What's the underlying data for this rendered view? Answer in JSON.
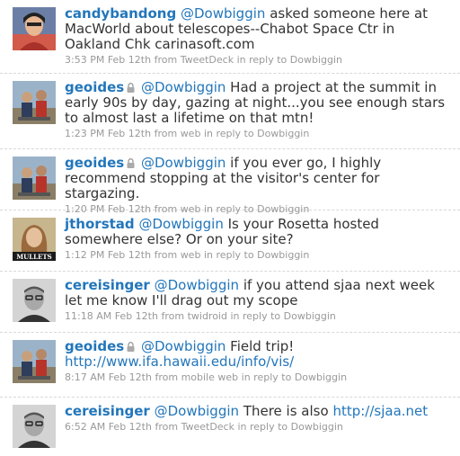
{
  "tweets": [
    {
      "user": "candybandong",
      "avatar": "candybandong-avatar",
      "protected": false,
      "mention": "@Dowbiggin",
      "text": "asked someone here at MacWorld about telescopes--Chabot Space Ctr in Oakland Chk carinasoft.com",
      "link": "",
      "time": "3:53 PM Feb 12th",
      "from_label": "from",
      "source": "TweetDeck",
      "reply_label": "in reply to",
      "reply_to": "Dowbiggin"
    },
    {
      "user": "geoides",
      "avatar": "geoides-avatar",
      "protected": true,
      "mention": "@Dowbiggin",
      "text": "Had a project at the summit in early 90s by day, gazing at night...you see enough stars to almost last a lifetime on that mtn!",
      "link": "",
      "time": "1:23 PM Feb 12th",
      "from_label": "from",
      "source": "web",
      "reply_label": "in reply to",
      "reply_to": "Dowbiggin"
    },
    {
      "user": "geoides",
      "avatar": "geoides-avatar",
      "protected": true,
      "mention": "@Dowbiggin",
      "text": "if you ever go, I highly recommend stopping at the visitor's center for stargazing.",
      "link": "",
      "time": "1:20 PM Feb 12th",
      "from_label": "from",
      "source": "web",
      "reply_label": "in reply to",
      "reply_to": "Dowbiggin"
    },
    {
      "user": "jthorstad",
      "avatar": "jthorstad-avatar",
      "avatar_caption": "MULLETS",
      "protected": false,
      "mention": "@Dowbiggin",
      "text": "Is your Rosetta hosted somewhere else? Or on your site?",
      "link": "",
      "time": "1:12 PM Feb 12th",
      "from_label": "from",
      "source": "web",
      "reply_label": "in reply to",
      "reply_to": "Dowbiggin"
    },
    {
      "user": "cereisinger",
      "avatar": "cereisinger-avatar",
      "protected": false,
      "mention": "@Dowbiggin",
      "text": "if you attend sjaa next week let me know I'll drag out my scope",
      "link": "",
      "time": "11:18 AM Feb 12th",
      "from_label": "from",
      "source": "twidroid",
      "reply_label": "in reply to",
      "reply_to": "Dowbiggin"
    },
    {
      "user": "geoides",
      "avatar": "geoides-avatar",
      "protected": true,
      "mention": "@Dowbiggin",
      "text": "Field trip!",
      "link": "http://www.ifa.hawaii.edu/info/vis/",
      "time": "8:17 AM Feb 12th",
      "from_label": "from",
      "source": "mobile web",
      "reply_label": "in reply to",
      "reply_to": "Dowbiggin"
    },
    {
      "user": "cereisinger",
      "avatar": "cereisinger-avatar",
      "protected": false,
      "mention": "@Dowbiggin",
      "text": "There is also",
      "link": "http://sjaa.net",
      "time": "6:52 AM Feb 12th",
      "from_label": "from",
      "source": "TweetDeck",
      "reply_label": "in reply to",
      "reply_to": "Dowbiggin"
    }
  ],
  "colors": {
    "link": "#2276bb",
    "text": "#333333",
    "meta": "#999999"
  },
  "icons": {
    "protected": "lock-icon"
  }
}
